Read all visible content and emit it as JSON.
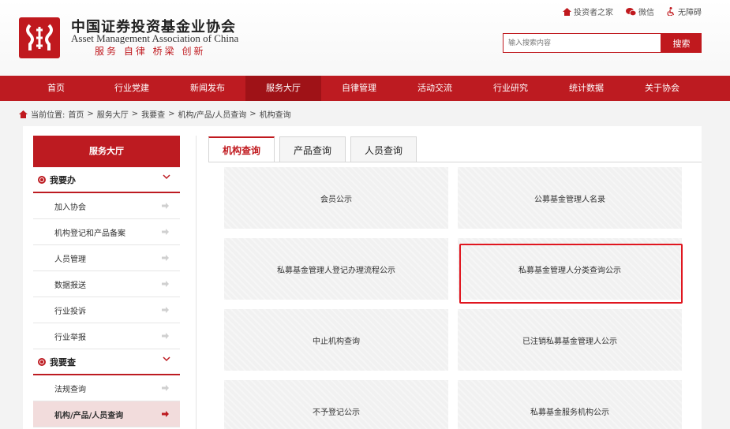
{
  "header": {
    "org_name_cn": "中国证券投资基金业协会",
    "org_name_en": "Asset Management Association of China",
    "slogan": "服务 自律 桥梁 创新"
  },
  "top_links": [
    "投资者之家",
    "微信",
    "无障碍"
  ],
  "search": {
    "placeholder": "输入搜索内容",
    "button_label": "搜索"
  },
  "nav": {
    "items": [
      "首页",
      "行业党建",
      "新闻发布",
      "服务大厅",
      "自律管理",
      "活动交流",
      "行业研究",
      "统计数据",
      "关于协会"
    ],
    "active": "服务大厅"
  },
  "breadcrumb": {
    "prefix": "当前位置:",
    "path": [
      "首页",
      "服务大厅",
      "我要查",
      "机构/产品/人员查询",
      "机构查询"
    ]
  },
  "sidebar": {
    "title": "服务大厅",
    "group1": {
      "label": "我要办",
      "items": [
        "加入协会",
        "机构登记和产品备案",
        "人员管理",
        "数据报送",
        "行业投诉",
        "行业举报"
      ]
    },
    "group2": {
      "label": "我要查",
      "items": [
        "法规查询",
        "机构/产品/人员查询"
      ],
      "active": "机构/产品/人员查询"
    }
  },
  "tabs": [
    "机构查询",
    "产品查询",
    "人员查询"
  ],
  "active_tab": "机构查询",
  "cards": [
    "会员公示",
    "公募基金管理人名录",
    "私募基金管理人登记办理流程公示",
    "私募基金管理人分类查询公示",
    "中止机构查询",
    "已注销私募基金管理人公示",
    "不予登记公示",
    "私募基金服务机构公示"
  ],
  "highlighted_card": "私募基金管理人分类查询公示",
  "colors": {
    "brand_red": "#bd1b21",
    "highlight_red": "#e0161f",
    "nav_active": "#9f1217"
  }
}
